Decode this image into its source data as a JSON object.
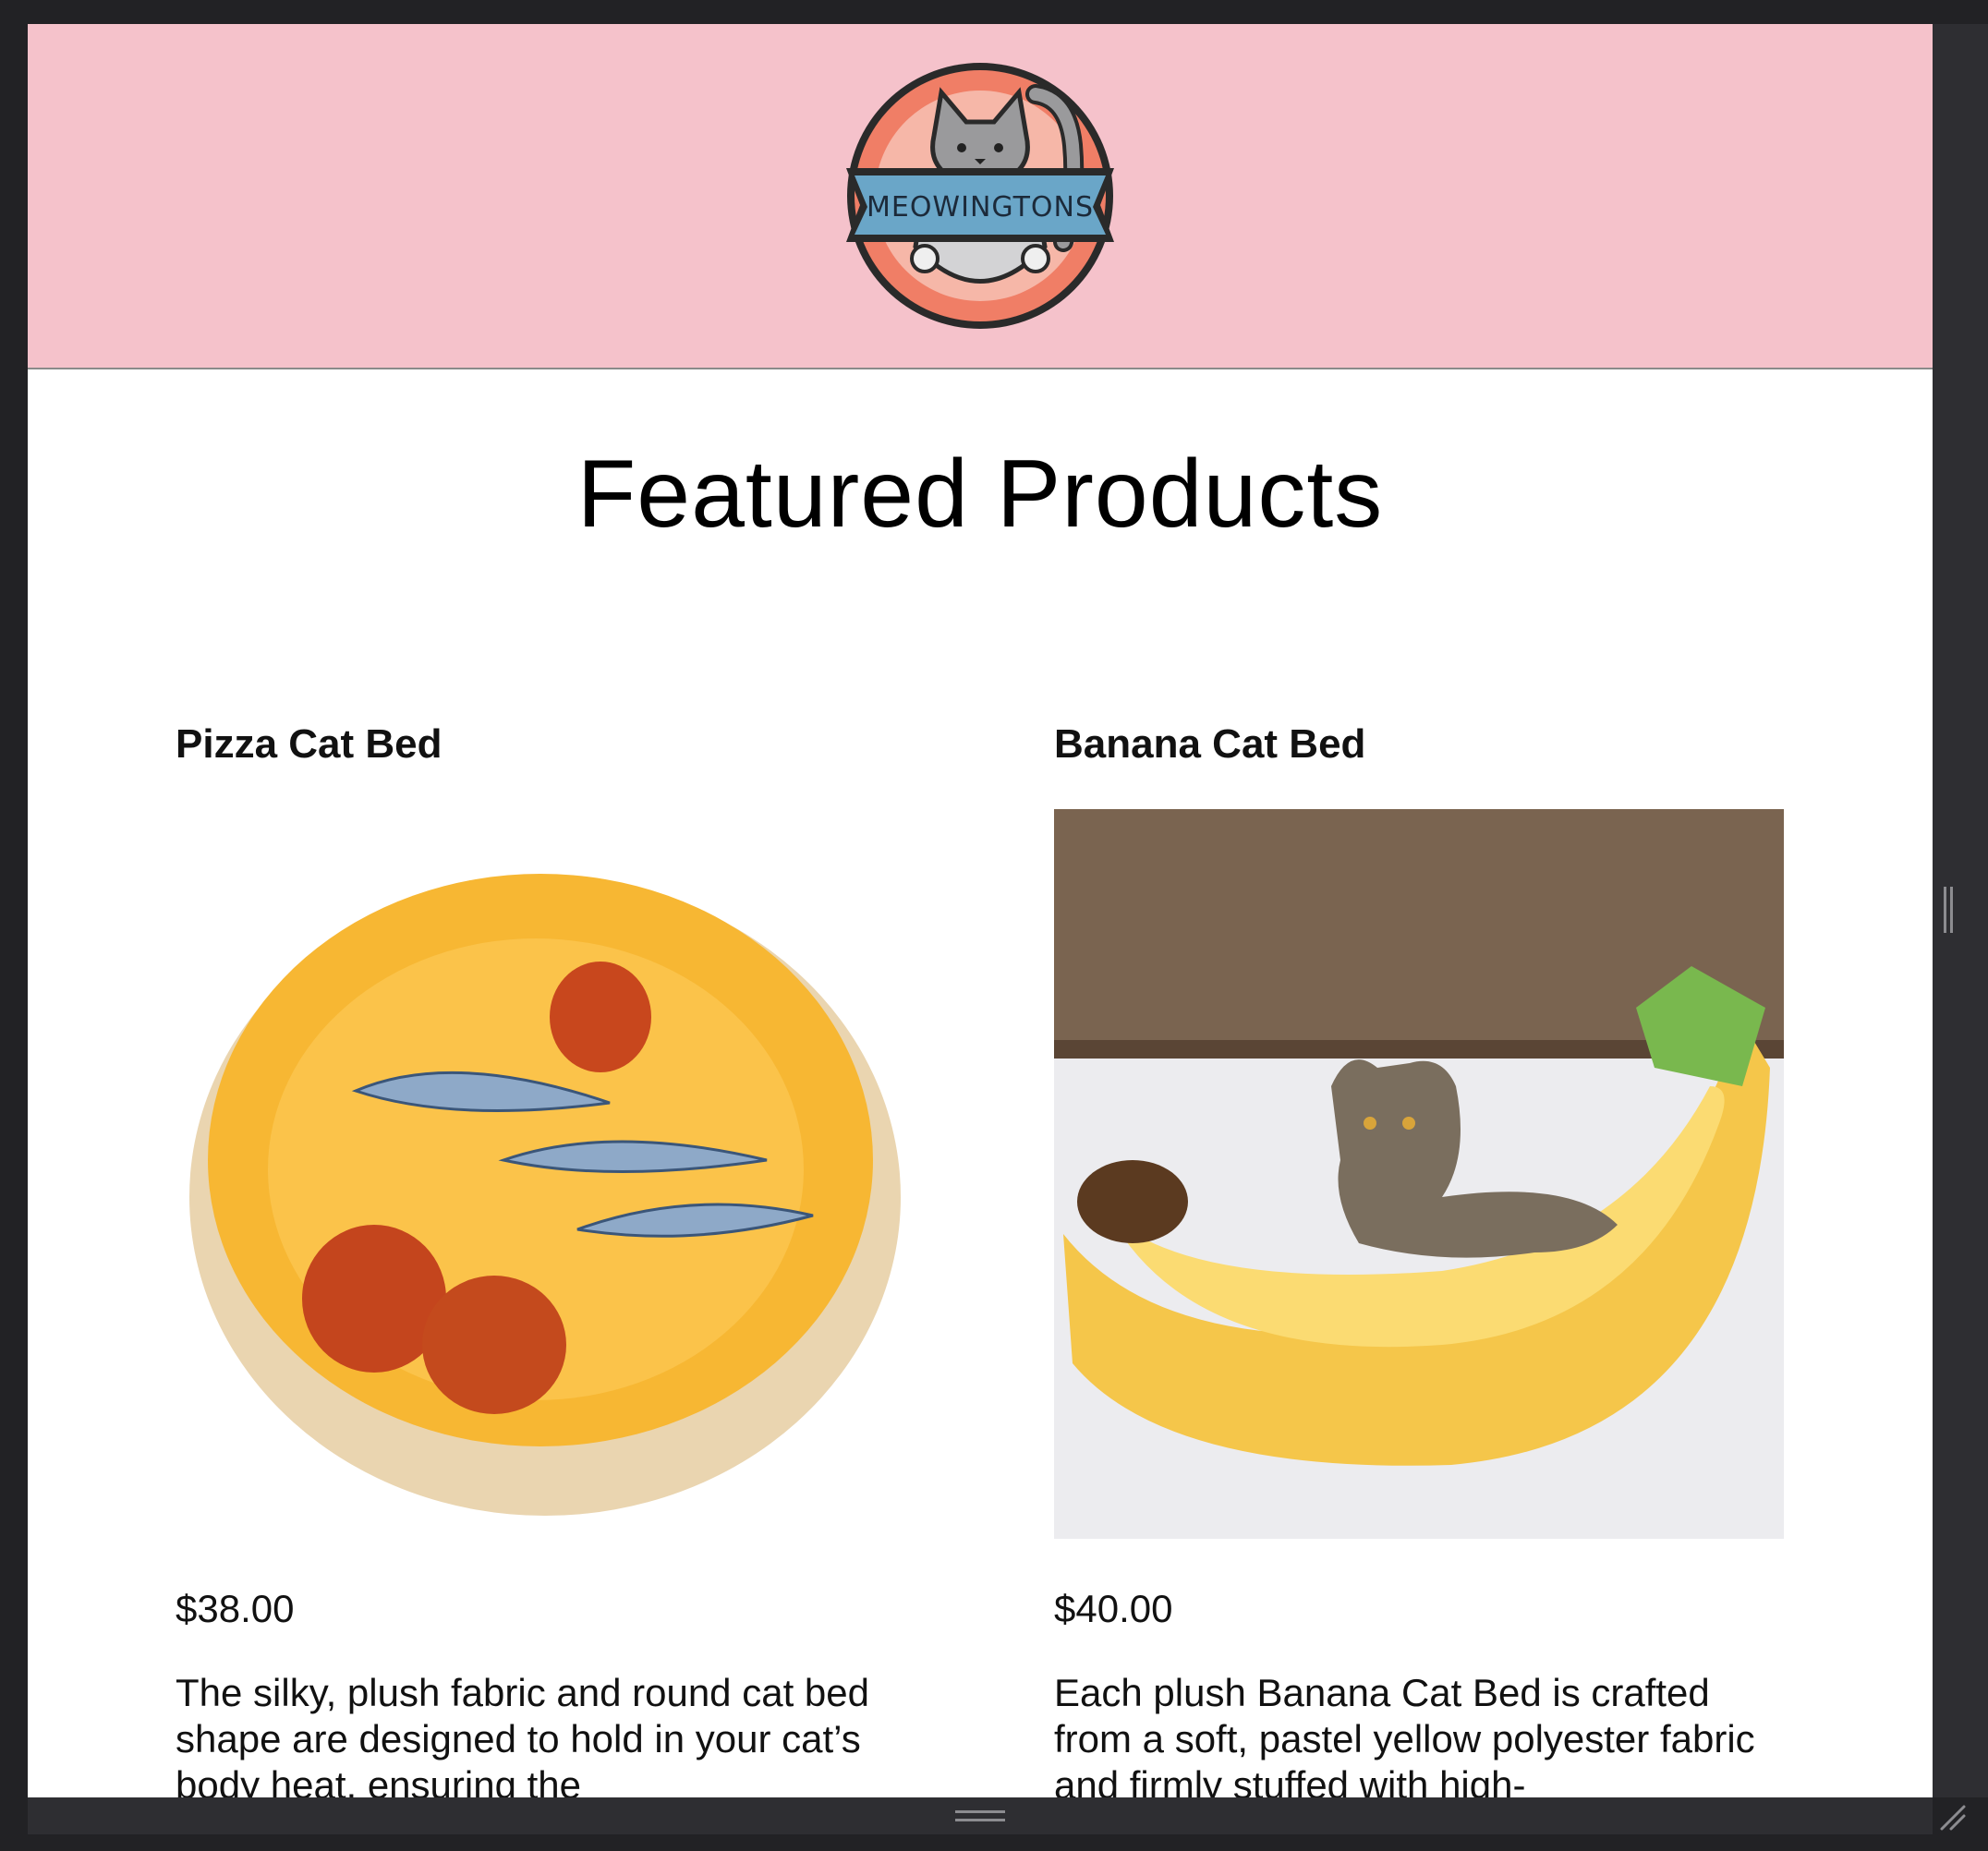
{
  "brand": {
    "logo_text": "MEOWINGTONS",
    "header_color": "#f5c2cb"
  },
  "main": {
    "title": "Featured Products",
    "products": [
      {
        "name": "Pizza Cat Bed",
        "image_alt": "Pizza cat bed with fish toys",
        "price": "$38.00",
        "description": "The silky, plush fabric and round cat bed shape are designed to hold in your cat’s body heat, ensuring the"
      },
      {
        "name": "Banana Cat Bed",
        "image_alt": "Tabby cat in banana cat bed",
        "price": "$40.00",
        "description": "Each plush Banana Cat Bed is crafted from a soft, pastel yellow polyester fabric and firmly stuffed with high-"
      }
    ]
  }
}
